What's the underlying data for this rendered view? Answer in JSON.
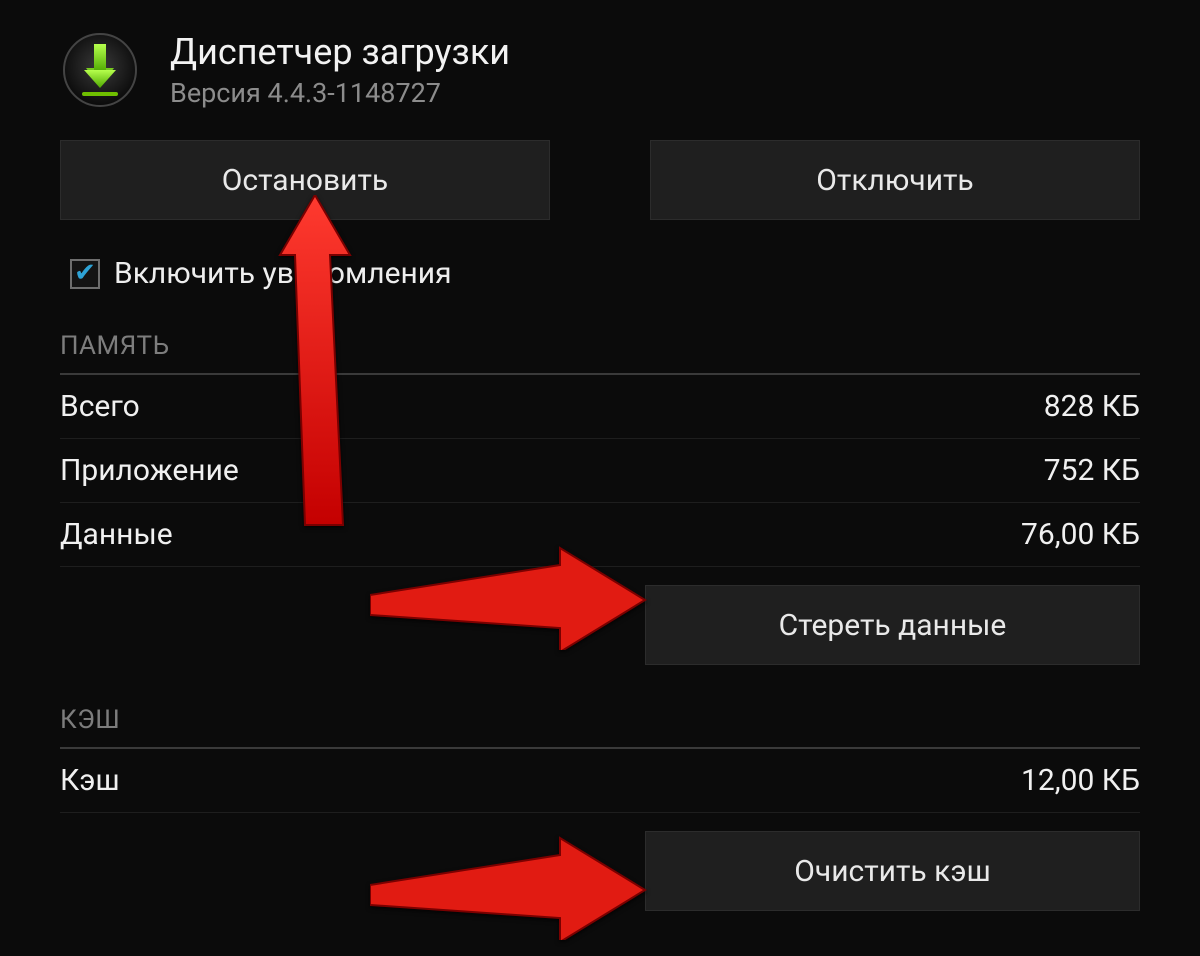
{
  "header": {
    "title": "Диспетчер загрузки",
    "version": "Версия 4.4.3-1148727"
  },
  "actions": {
    "stop": "Остановить",
    "disable": "Отключить"
  },
  "checkbox": {
    "label": "Включить уведомления",
    "checked": true
  },
  "memory_section": {
    "title": "ПАМЯТЬ",
    "total_label": "Всего",
    "total_value": "828 КБ",
    "app_label": "Приложение",
    "app_value": "752 КБ",
    "data_label": "Данные",
    "data_value": "76,00 КБ",
    "clear_data_button": "Стереть данные"
  },
  "cache_section": {
    "title": "КЭШ",
    "cache_label": "Кэш",
    "cache_value": "12,00 КБ",
    "clear_cache_button": "Очистить кэш"
  }
}
